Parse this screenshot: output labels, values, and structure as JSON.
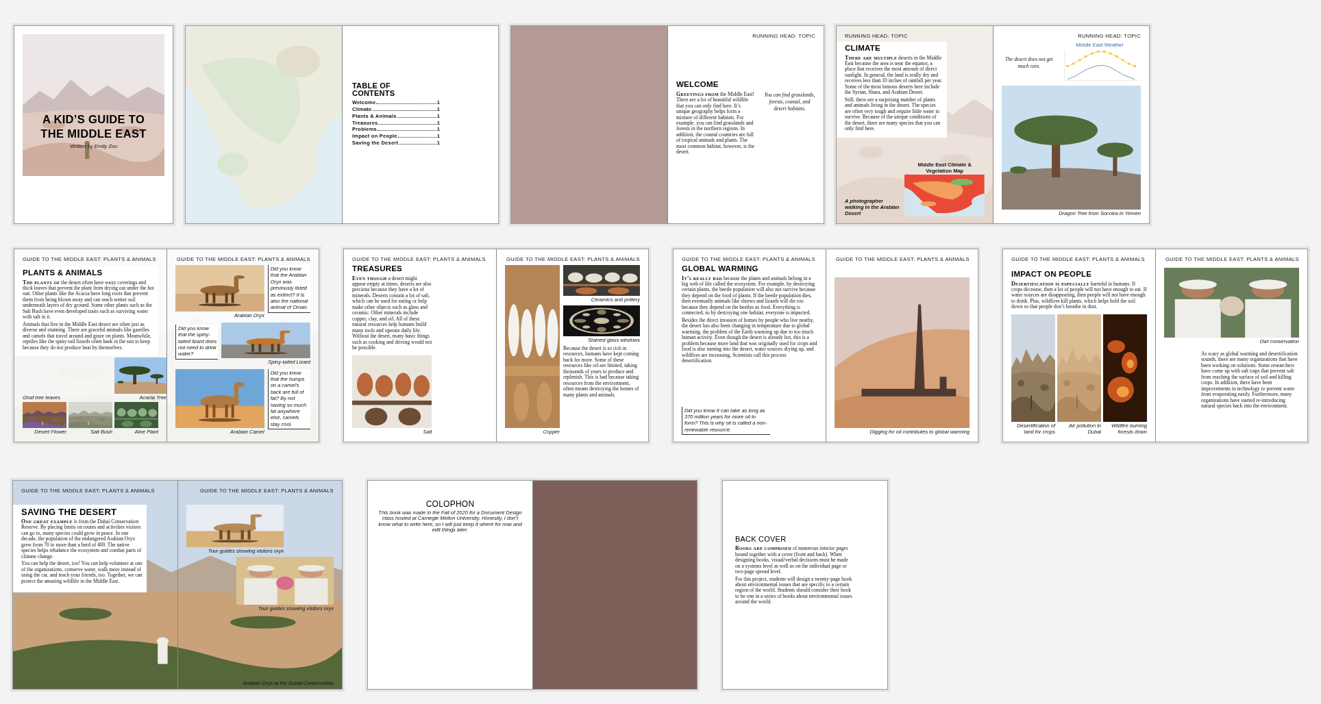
{
  "rows": [
    {
      "spreads": [
        {
          "pages": [
            {
              "kind": "cover",
              "backdrop": true,
              "heading": "A KID’S GUIDE TO THE MIDDLE EAST",
              "byline": "Written by Emily Zou"
            }
          ]
        },
        {
          "pages": [
            {
              "kind": "picture",
              "backdrop": true
            },
            {
              "kind": "toc",
              "heading": "TABLE OF CONTENTS",
              "toc": [
                {
                  "label": "Welcome",
                  "page": "1"
                },
                {
                  "label": "Climate",
                  "page": "1"
                },
                {
                  "label": "Plants & Animals",
                  "page": "1"
                },
                {
                  "label": "Treasures",
                  "page": "1"
                },
                {
                  "label": "Problems",
                  "page": "1"
                },
                {
                  "label": "Impact on People",
                  "page": "1"
                },
                {
                  "label": "Saving the Desert",
                  "page": "1"
                }
              ]
            }
          ]
        },
        {
          "pages": [
            {
              "kind": "color",
              "color": "#b39a95"
            },
            {
              "kind": "welcome",
              "running_head": "RUNNING HEAD: TOPIC",
              "heading": "WELCOME",
              "paragraphs": [
                "**Greetings from** the Middle East! There are a lot of beautiful wildlife that you can only find here. It’s unique geography helps form a mixture of different habitats. For example, you can find grasslands and forests in the northern regions. In addition, the coastal countries are full of tropical animals and plants. The most common habitat, however, is the desert."
              ],
              "quote": "You can find grasslands, forests, coastal, and desert habitats."
            }
          ]
        },
        {
          "pages": [
            {
              "kind": "climate-l",
              "backdrop": true,
              "running_head": "RUNNING HEAD: TOPIC",
              "heading": "CLIMATE",
              "paragraphs": [
                "**There are multiple** deserts in the Middle East because the area is near the equator, a place that receives the most amount of direct sunlight. In general, the land is really dry and receives less than 10 inches of rainfall per year. Some of the most famous deserts here include the Syrian, Shara, and Arabian Desert.",
                "Still, there are a surprising number of plants and animals living in the desert. The species are often very tough and require little water to survive. Because of the unique conditions of the desert, there are many species that you can only find here."
              ],
              "bg_caption": "A photographer walking in the Arabian Desert",
              "figures": [
                {
                  "title": "Middle East Climate & Vegetation Map"
                }
              ]
            },
            {
              "kind": "climate-r",
              "running_head": "RUNNING HEAD: TOPIC",
              "quote": "The desert does not get much rain.",
              "chart": {
                "title": "Middle East Weather"
              },
              "figures": [
                {
                  "caption": "Dragon Tree from Socotra in Yemen"
                }
              ]
            }
          ]
        }
      ]
    },
    {
      "spreads": [
        {
          "backdrop": true,
          "faded": true,
          "pages": [
            {
              "kind": "plants-l",
              "running_head": "GUIDE TO THE MIDDLE EAST: PLANTS & ANIMALS",
              "heading": "PLANTS & ANIMALS",
              "paragraphs": [
                "**The plants of** the desert often have waxy coverings and thick leaves that prevent the plant from drying out under the hot sun. Other plants like the Acacia have long roots that prevent them from being blown away and can reach wetter soil underneath layers of dry ground. Some other plants such as the Salt Bush have even developed traits such as surviving water with salt in it.",
                "Animals that live in the Middle East desert are often just as diverse and stunning. There are graceful animals like gazelles and camels that travel around and graze on plants. Meanwhile, reptiles like the spiny-tail lizards often bask in the sun to keep because they do not produce heat by themselves."
              ],
              "bg_caption": "Ghaf tree leaves",
              "figures": [
                {
                  "caption": "Acacia Tree"
                },
                {
                  "caption": "Desert Flower"
                },
                {
                  "caption": "Salt Bush"
                },
                {
                  "caption": "Aloe Plant"
                }
              ]
            },
            {
              "kind": "plants-r",
              "running_head": "GUIDE TO THE MIDDLE EAST: PLANTS & ANIMALS",
              "figures": [
                {
                  "caption": "Arabian Oryx",
                  "note": "Did you know that the Arabian Oryx was previously listed as extinct? It is also the national animal of Oman."
                },
                {
                  "caption": "Spiny-tailed Lizard",
                  "note": "Did you know that the spiny-tailed lizard does not need to drink water?"
                },
                {
                  "caption": "Arabian Camel",
                  "note": "Did you know that the humps on a camel’s back are full of fat? By not having so much fat anywhere else, camels stay cool."
                }
              ]
            }
          ]
        },
        {
          "pages": [
            {
              "kind": "treasures-l",
              "running_head": "GUIDE TO THE MIDDLE EAST: PLANTS & ANIMALS",
              "heading": "TREASURES",
              "paragraphs": [
                "**Even though** a desert might appear empty at times, deserts are also precious because they have a lot of minerals. Deserts contain a lot of salt, which can be used for eating or help make other objects such as glass and ceramic. Other minerals include copper, clay, and oil. All of these natural resources help humans build many tools and operate daily life. Without the desert, many basic things such as cooking and driving would not be possible."
              ],
              "figures": [
                {
                  "caption": "Salt"
                }
              ]
            },
            {
              "kind": "treasures-r",
              "running_head": "GUIDE TO THE MIDDLE EAST: PLANTS & ANIMALS",
              "figures": [
                {
                  "caption": "Copper"
                },
                {
                  "caption": "Ceramics and pottery"
                },
                {
                  "caption": "Stained glass windows"
                }
              ],
              "paragraphs": [
                "Because the desert is so rich in resources, humans have kept coming back for more. Some of these resources like oil are limited, taking thousands of years to produce and replenish. This is bad because taking resources from the environment, often means destroying the homes of many plants and animals."
              ]
            }
          ]
        },
        {
          "pages": [
            {
              "kind": "global-l",
              "running_head": "GUIDE TO THE MIDDLE EAST: PLANTS & ANIMALS",
              "heading": "GLOBAL WARMING",
              "paragraphs": [
                "**It’s really bad** because the plants and animals belong in a big web of life called the ecosystem. For example, by destroying certain plants, the beetle population will also not survive because they depend on the food of plants. If the beetle population dies, then eventually animals like shrews and lizards will die too because they depend on the beetles as food. Everything is connected, so by destroying one habitat, everyone is impacted.",
                "Besides the direct invasion of homes by people who live nearby, the desert has also been changing in temperature due to global warming, the problem of the Earth warming up due to too much human activity. Even though the desert is already hot, this is a problem because more land that was originally used for crops and food is also turning into the desert, water sources drying up, and wildfires are increasing. Scientists call this process desertification."
              ],
              "note": "Did you know it can take as long as 370 million years for more oil to form? This is why oil is called a non-renewable resource."
            },
            {
              "kind": "global-r",
              "running_head": "GUIDE TO THE MIDDLE EAST: PLANTS & ANIMALS",
              "figures": [
                {
                  "caption": "Digging for oil contributes to global warming"
                }
              ]
            }
          ]
        },
        {
          "pages": [
            {
              "kind": "impact-l",
              "running_head": "GUIDE TO THE MIDDLE EAST: PLANTS & ANIMALS",
              "heading": "IMPACT ON PEOPLE",
              "paragraphs": [
                "**Desertification is especially** harmful to humans. If crops decrease, then a lot of people will not have enough to eat. If water sources are disappearing, then people will not have enough to drink. Plus, wildfires kill plants, which helps hold the soil down so that people don’t breathe in dust."
              ],
              "figures": [
                {
                  "caption": "Desertification of land for crops"
                },
                {
                  "caption": "Air pollution in Dubai"
                },
                {
                  "caption": "Wildfire burning forests down"
                }
              ]
            },
            {
              "kind": "impact-r",
              "running_head": "GUIDE TO THE MIDDLE EAST: PLANTS & ANIMALS",
              "figures": [
                {
                  "caption": "Owl conservation"
                }
              ],
              "paragraphs": [
                "As scary as global warming and desertification sounds, there are many organizations that have been working on solutions. Some researchers have come up with salt traps that prevent salt from reaching the surface of soil and killing crops. In addition, there have been improvements in technology to prevent water from evaporating easily. Furthermore, many organizations have started re-introducing natural species back into the environment."
              ]
            }
          ]
        }
      ]
    },
    {
      "spreads": [
        {
          "backdrop": true,
          "pages": [
            {
              "kind": "saving-l",
              "running_head": "GUIDE TO THE MIDDLE EAST: PLANTS & ANIMALS",
              "heading": "SAVING THE DESERT",
              "paragraphs": [
                "**One great example** is from the Dubai Conservation Reserve. By placing limits on routes and activities visitors can go to, many species could grow in peace. In one decade, the population of the endangered Arabian Oryx grew from 70 to more than a herd of 400. The native species helps rebalance the ecosystem and combat parts of climate change.",
                "You can help the desert, too! You can help volunteer at one of the organizations, conserve water, walk more instead of using the car, and teach your friends, too. Together, we can protect the amazing wildlife in the Middle East."
              ]
            },
            {
              "kind": "saving-r",
              "running_head": "GUIDE TO THE MIDDLE EAST: PLANTS & ANIMALS",
              "figures": [
                {
                  "caption": "Tour guides showing visitors oryx"
                },
                {
                  "caption": "Tour guides showing visitors oryx"
                }
              ],
              "bg_caption": "Arabian Oryx at the Dubai Conservation"
            }
          ]
        },
        {
          "pages": [
            {
              "kind": "colophon",
              "heading": "COLOPHON",
              "paragraphs": [
                "This book was made in the Fall of 2020 for a Document Design class hosted at Carnegie Mellon University. Honestly, I don’t know what to write here, so I will just keep it where for now and edit things later."
              ]
            },
            {
              "kind": "color",
              "color": "#7d5e58"
            }
          ]
        },
        {
          "pages": [
            {
              "kind": "back",
              "heading": "BACK COVER",
              "paragraphs": [
                "**Books are comprised** of numerous interior pages bound together with a cover (front and back). When designing books, visual/verbal decisions must be made on a systems level as well as on the individual page or two-page spread level.",
                "For this project, students will design a twenty-page book about environmental issues that are specific to a certain region of the world. Students should consider their book to be one in a series of books about environmental issues around the world."
              ]
            }
          ]
        }
      ]
    }
  ]
}
